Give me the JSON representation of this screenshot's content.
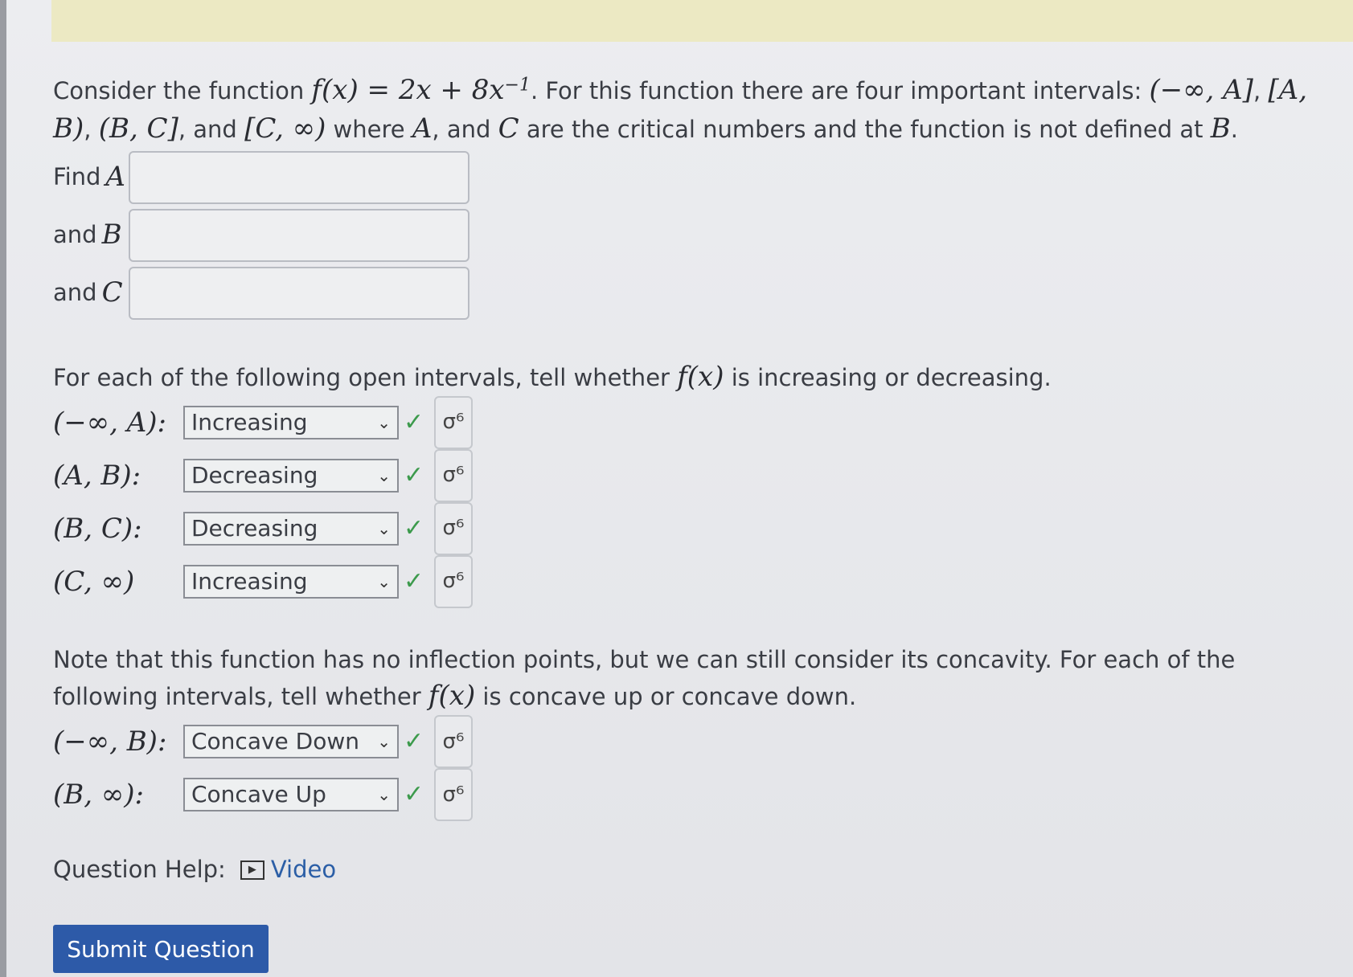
{
  "problem": {
    "intro_before": "Consider the function ",
    "function_expr": "f(x) = 2x + 8x",
    "exponent": "−1",
    "intro_after": ". For this function there are four important intervals: ",
    "interval_1": "(−∞, A]",
    "comma": ", ",
    "interval_2": "[A, B)",
    "interval_3": "(B, C]",
    "and_word": ", and ",
    "interval_4": "[C, ∞)",
    "where_text": " where ",
    "var_A": "A",
    "and_text": ", and ",
    "var_C": "C",
    "critical_text": " are the critical numbers and the function is not defined at ",
    "var_B": "B",
    "period": "."
  },
  "find": {
    "find_label": "Find",
    "and_label": "and",
    "A": "A",
    "B": "B",
    "C": "C",
    "A_value": "",
    "B_value": "",
    "C_value": ""
  },
  "increasing_section": {
    "prompt_before": "For each of the following open intervals, tell whether ",
    "fx": "f(x)",
    "prompt_after": " is increasing or decreasing.",
    "rows": [
      {
        "interval": "(−∞, A):",
        "value": "Increasing"
      },
      {
        "interval": "(A, B):",
        "value": "Decreasing"
      },
      {
        "interval": "(B, C):",
        "value": "Decreasing"
      },
      {
        "interval": "(C, ∞)",
        "value": "Increasing"
      }
    ]
  },
  "concavity_section": {
    "prompt_before": "Note that this function has no inflection points, but we can still consider its concavity. For each of the following intervals, tell whether ",
    "fx": "f(x)",
    "prompt_after": " is concave up or concave down.",
    "rows": [
      {
        "interval": "(−∞, B):",
        "value": "Concave Down"
      },
      {
        "interval": "(B, ∞):",
        "value": "Concave Up"
      }
    ]
  },
  "icons": {
    "check": "✓",
    "chevron": "⌄",
    "symbol": "σ⁶",
    "video": "▶"
  },
  "help": {
    "label": "Question Help:",
    "video": "Video"
  },
  "submit": {
    "label": "Submit Question"
  }
}
